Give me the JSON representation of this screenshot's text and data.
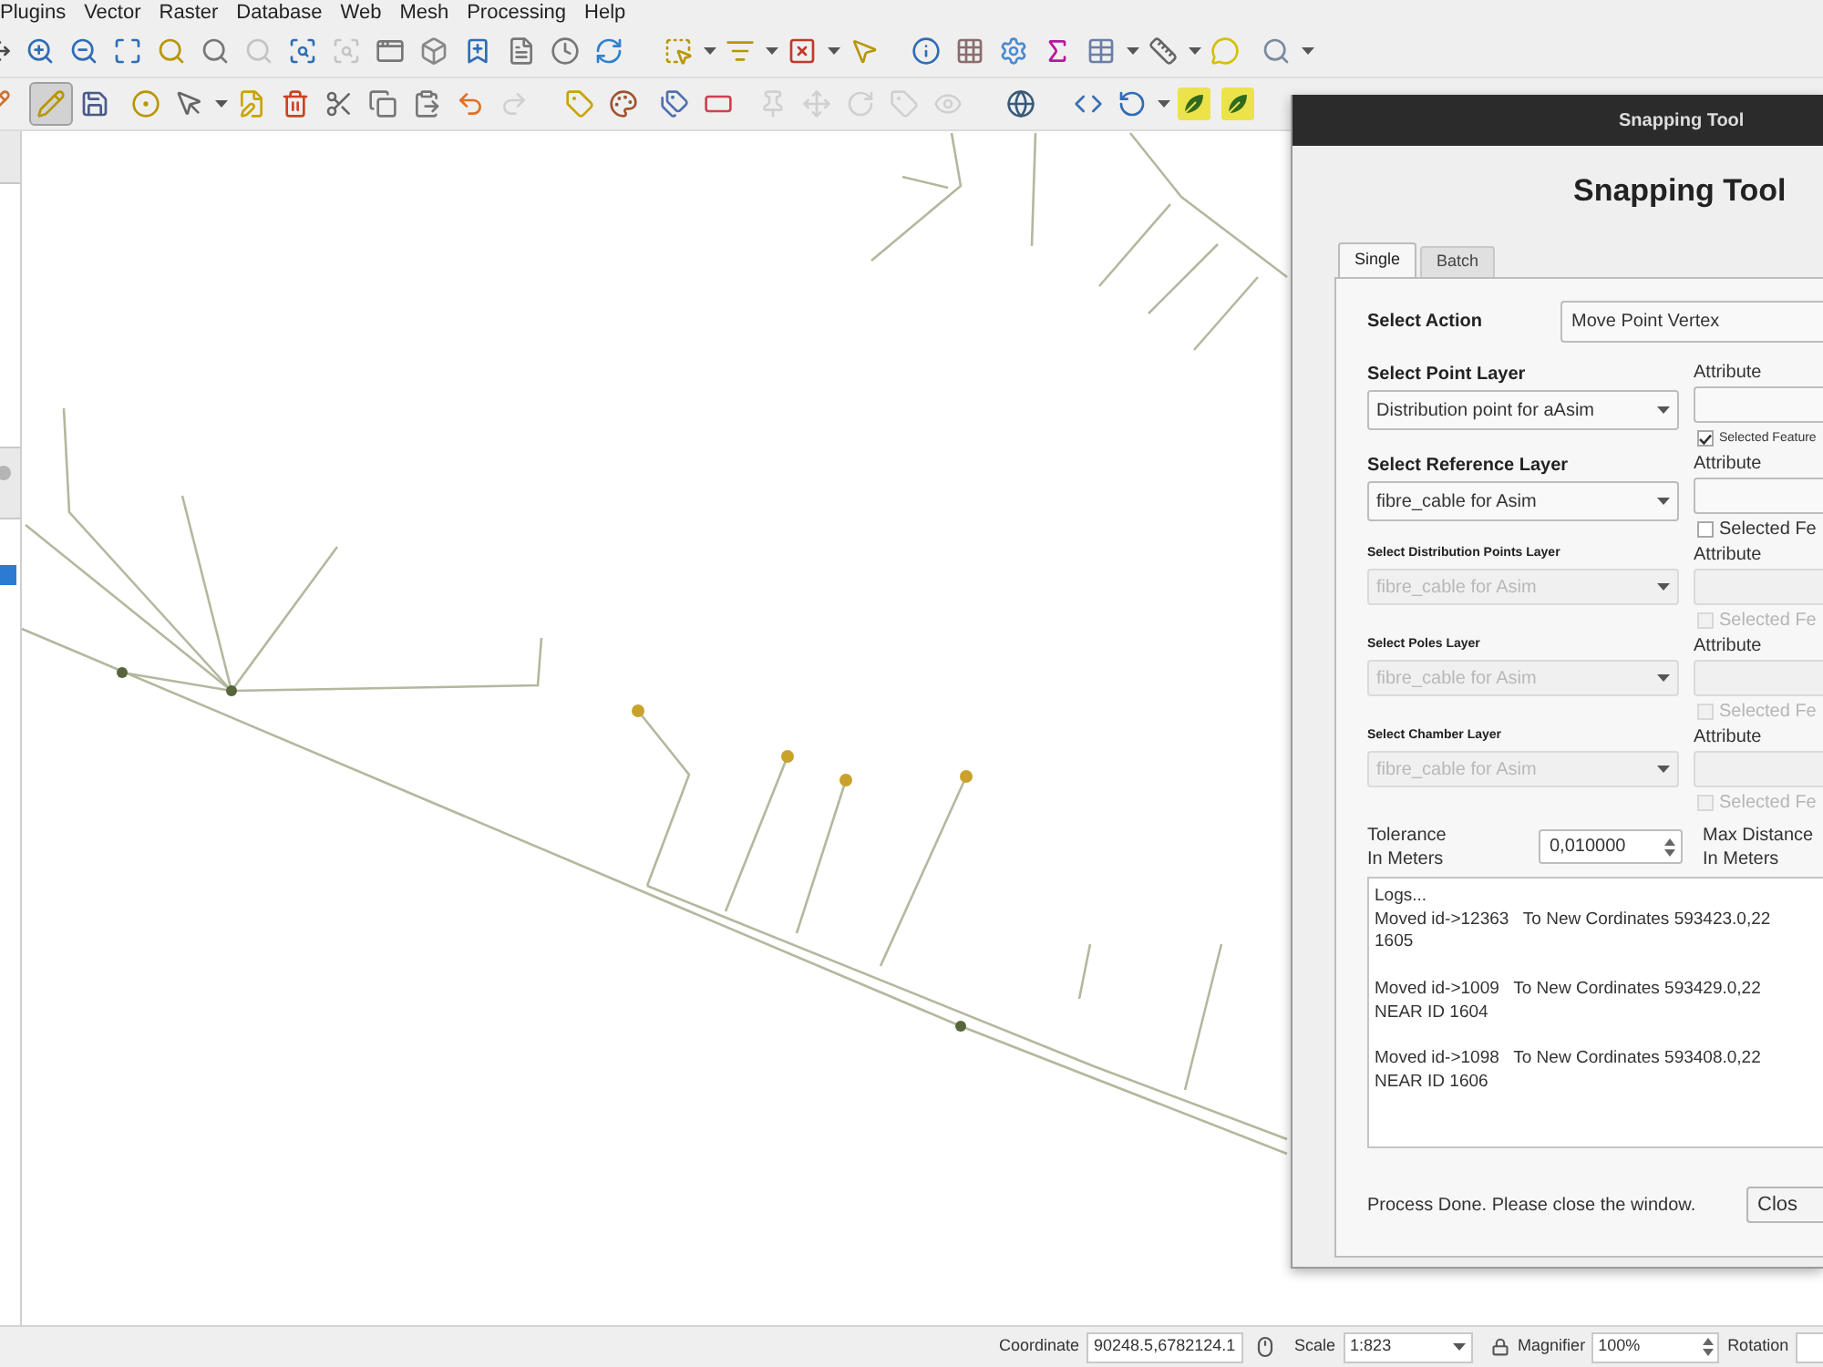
{
  "menu_bar": {
    "items": [
      "Plugins",
      "Vector",
      "Raster",
      "Database",
      "Web",
      "Mesh",
      "Processing",
      "Help"
    ]
  },
  "map_toolbar": {
    "buttons": [
      {
        "disabled": false
      },
      {
        "disabled": false
      },
      {
        "disabled": false
      },
      {
        "disabled": false
      },
      {
        "disabled": false
      },
      {
        "disabled": false
      },
      {
        "disabled": true
      },
      {
        "disabled": false
      },
      {
        "disabled": true
      },
      {
        "disabled": false
      },
      {
        "disabled": false
      },
      {
        "disabled": false
      },
      {
        "disabled": false
      },
      {
        "disabled": false
      },
      {
        "disabled": false
      },
      {
        "disabled": false
      },
      {
        "disabled": false
      },
      {
        "disabled": false
      },
      {
        "disabled": false
      },
      {
        "disabled": false
      },
      {
        "disabled": false
      },
      {
        "disabled": false
      },
      {
        "disabled": false
      },
      {
        "disabled": false
      },
      {
        "disabled": false
      },
      {
        "disabled": false
      },
      {
        "disabled": false
      }
    ]
  },
  "edit_toolbar": {
    "buttons": [
      {
        "disabled": false,
        "on": false
      },
      {
        "disabled": false,
        "on": true
      },
      {
        "disabled": false,
        "on": false
      },
      {
        "disabled": false,
        "on": false
      },
      {
        "disabled": false,
        "on": false
      },
      {
        "disabled": false,
        "on": false
      },
      {
        "disabled": false,
        "on": false
      },
      {
        "disabled": false,
        "on": false
      },
      {
        "disabled": false,
        "on": false
      },
      {
        "disabled": false,
        "on": false
      },
      {
        "disabled": false,
        "on": false
      },
      {
        "disabled": true,
        "on": false
      },
      {
        "disabled": false,
        "on": false
      },
      {
        "disabled": false,
        "on": false
      },
      {
        "disabled": false,
        "on": false
      },
      {
        "disabled": false,
        "on": false
      },
      {
        "disabled": true,
        "on": false
      },
      {
        "disabled": true,
        "on": false
      },
      {
        "disabled": true,
        "on": false
      },
      {
        "disabled": true,
        "on": false
      },
      {
        "disabled": true,
        "on": false
      },
      {
        "disabled": false,
        "on": false
      },
      {
        "disabled": false,
        "on": false
      },
      {
        "disabled": false,
        "on": false
      },
      {
        "disabled": false,
        "on": false
      },
      {
        "disabled": false,
        "on": false
      }
    ]
  },
  "layers_panel": {
    "rows": [
      {
        "selected": true
      }
    ]
  },
  "dialog": {
    "title": "Snapping Tool",
    "heading": "Snapping Tool",
    "tabs": [
      {
        "label": "Single",
        "selected": true
      },
      {
        "label": "Batch",
        "selected": false
      }
    ],
    "action": {
      "label": "Select Action",
      "value": "Move Point Vertex"
    },
    "layers": [
      {
        "kind": "primary",
        "label": "Select Point Layer",
        "value": "Distribution point for aAsim",
        "disabled": false,
        "attribute_label": "Attribute",
        "checkbox": {
          "kind": "small",
          "label": "Selected Feature",
          "checked": true,
          "disabled": false
        }
      },
      {
        "kind": "primary",
        "label": "Select Reference Layer",
        "value": "fibre_cable for Asim",
        "disabled": false,
        "attribute_label": "Attribute",
        "checkbox": {
          "kind": "normal",
          "label": "Selected Fe",
          "checked": false,
          "disabled": false
        }
      },
      {
        "kind": "secondary",
        "label": "Select Distribution Points Layer",
        "value": "fibre_cable for Asim",
        "disabled": true,
        "attribute_label": "Attribute",
        "checkbox": {
          "kind": "normal",
          "label": "Selected Fe",
          "checked": false,
          "disabled": true
        }
      },
      {
        "kind": "secondary",
        "label": "Select Poles Layer",
        "value": "fibre_cable for Asim",
        "disabled": true,
        "attribute_label": "Attribute",
        "checkbox": {
          "kind": "normal",
          "label": "Selected Fe",
          "checked": false,
          "disabled": true
        }
      },
      {
        "kind": "secondary",
        "label": "Select Chamber Layer",
        "value": "fibre_cable for Asim",
        "disabled": true,
        "attribute_label": "Attribute",
        "checkbox": {
          "kind": "normal",
          "label": "Selected Fe",
          "checked": false,
          "disabled": true
        }
      }
    ],
    "tolerance": {
      "label": "Tolerance",
      "unit": "In Meters",
      "value": "0,010000"
    },
    "max_distance": {
      "label": "Max Distance",
      "unit": "In Meters"
    },
    "log": {
      "title": "Logs...",
      "entries": [
        {
          "lines": [
            "Moved id->12363   To New Cordinates 593423.0,22",
            "1605"
          ]
        },
        {
          "lines": [
            "Moved id->1009   To New Cordinates 593429.0,22",
            "NEAR ID 1604"
          ]
        },
        {
          "lines": [
            "Moved id->1098   To New Cordinates 593408.0,22",
            "NEAR ID 1606"
          ]
        }
      ]
    },
    "status": "Process Done. Please close the window.",
    "close_button": "Clos"
  },
  "status_bar": {
    "coordinate": {
      "label": "Coordinate",
      "value": "90248.5,6782124.1"
    },
    "scale": {
      "label": "Scale",
      "value": "1:823"
    },
    "magnifier": {
      "label": "Magnifier",
      "value": "100%"
    },
    "rotation": {
      "label": "Rotation"
    }
  }
}
